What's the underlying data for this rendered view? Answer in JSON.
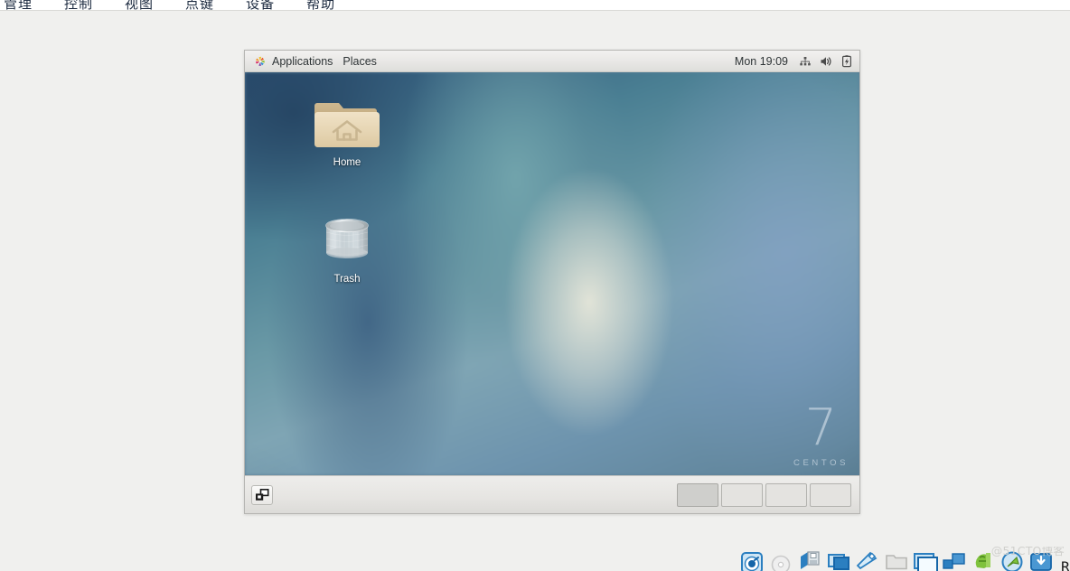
{
  "host_app": {
    "menubar": {
      "items": [
        {
          "label": "管理",
          "name": "menu-manage"
        },
        {
          "label": "控制",
          "name": "menu-control"
        },
        {
          "label": "视图",
          "name": "menu-view"
        },
        {
          "label": "点键",
          "name": "menu-hotkey"
        },
        {
          "label": "设备",
          "name": "menu-devices"
        },
        {
          "label": "帮助",
          "name": "menu-help"
        }
      ]
    },
    "statusbar": {
      "host_key_label": "Right Ct",
      "watermark": "@51CTO博客",
      "icons": [
        {
          "name": "hard-disk-icon",
          "title": "hard disks"
        },
        {
          "name": "optical-disk-icon",
          "title": "optical drives"
        },
        {
          "name": "floppy-disk-icon",
          "title": "floppy drives"
        },
        {
          "name": "display-icon",
          "title": "display"
        },
        {
          "name": "usb-icon",
          "title": "usb devices"
        },
        {
          "name": "shared-folder-icon",
          "title": "shared folders"
        },
        {
          "name": "screen-capture-icon",
          "title": "recording"
        },
        {
          "name": "network-adapter-icon",
          "title": "network adapters"
        },
        {
          "name": "guest-additions-icon",
          "title": "guest additions"
        },
        {
          "name": "mouse-integration-icon",
          "title": "mouse integration"
        },
        {
          "name": "host-key-icon",
          "title": "host key"
        }
      ]
    }
  },
  "vm": {
    "top_panel": {
      "applications_label": "Applications",
      "places_label": "Places",
      "clock": "Mon 19:09",
      "tray": [
        {
          "name": "network-icon"
        },
        {
          "name": "volume-icon"
        },
        {
          "name": "battery-charging-icon"
        }
      ]
    },
    "desktop": {
      "icons": [
        {
          "name": "desktop-icon-home",
          "label": "Home",
          "icon": "home-folder-icon"
        },
        {
          "name": "desktop-icon-trash",
          "label": "Trash",
          "icon": "trash-can-icon"
        }
      ],
      "watermark": {
        "version": "7",
        "distro": "CENTOS"
      }
    },
    "bottom_panel": {
      "show_desktop_name": "show-desktop-icon",
      "workspaces": [
        {
          "label": "",
          "active": true
        },
        {
          "label": "",
          "active": false
        },
        {
          "label": "",
          "active": false
        },
        {
          "label": "",
          "active": false
        }
      ]
    }
  },
  "colors": {
    "panel_bg": "#e8e7e5",
    "desktop_blue": "#4a7f93",
    "desktop_dark_blue": "#2b5075",
    "folder_tan": "#e3d3b6",
    "accent_text": "#2e3436",
    "watermark_gray": "#d0d0cd"
  }
}
